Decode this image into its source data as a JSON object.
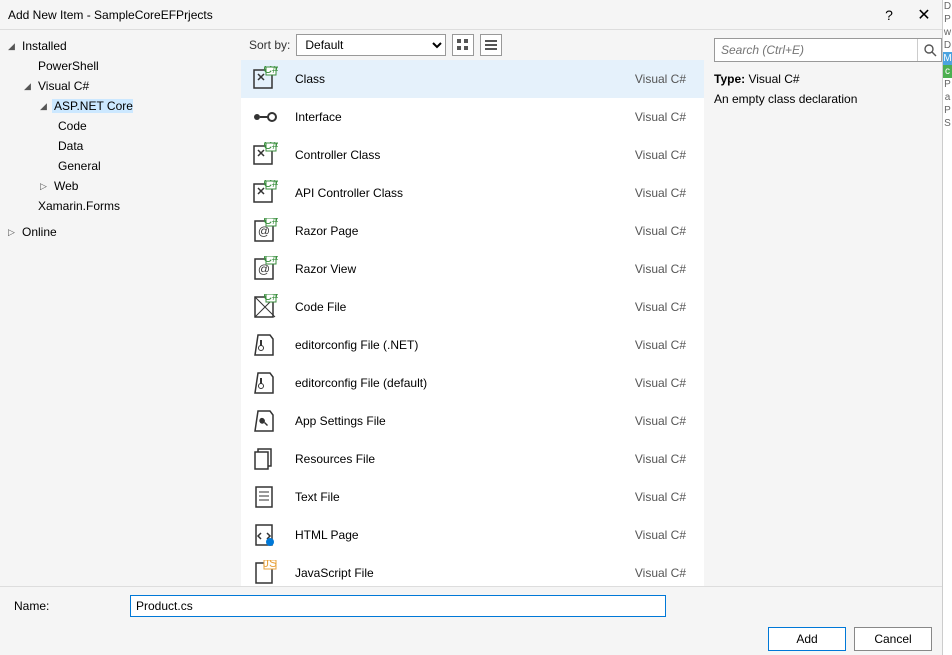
{
  "window": {
    "title": "Add New Item - SampleCoreEFPrjects",
    "help": "?",
    "close": "✕"
  },
  "sidebar": {
    "installed": "Installed",
    "powershell": "PowerShell",
    "visualcs": "Visual C#",
    "aspnetcore": "ASP.NET Core",
    "code": "Code",
    "data": "Data",
    "general": "General",
    "web": "Web",
    "xamarin": "Xamarin.Forms",
    "online": "Online"
  },
  "toolbar": {
    "sortby": "Sort by:",
    "sortvalue": "Default"
  },
  "templates": [
    {
      "name": "Class",
      "lang": "Visual C#",
      "selected": true,
      "icon": "class"
    },
    {
      "name": "Interface",
      "lang": "Visual C#",
      "icon": "interface"
    },
    {
      "name": "Controller Class",
      "lang": "Visual C#",
      "icon": "class"
    },
    {
      "name": "API Controller Class",
      "lang": "Visual C#",
      "icon": "class"
    },
    {
      "name": "Razor Page",
      "lang": "Visual C#",
      "icon": "razor"
    },
    {
      "name": "Razor View",
      "lang": "Visual C#",
      "icon": "razor"
    },
    {
      "name": "Code File",
      "lang": "Visual C#",
      "icon": "codefile"
    },
    {
      "name": "editorconfig File (.NET)",
      "lang": "Visual C#",
      "icon": "config"
    },
    {
      "name": "editorconfig File (default)",
      "lang": "Visual C#",
      "icon": "config"
    },
    {
      "name": "App Settings File",
      "lang": "Visual C#",
      "icon": "wrench"
    },
    {
      "name": "Resources File",
      "lang": "Visual C#",
      "icon": "files"
    },
    {
      "name": "Text File",
      "lang": "Visual C#",
      "icon": "text"
    },
    {
      "name": "HTML Page",
      "lang": "Visual C#",
      "icon": "html"
    },
    {
      "name": "JavaScript File",
      "lang": "Visual C#",
      "icon": "js"
    }
  ],
  "search": {
    "placeholder": "Search (Ctrl+E)"
  },
  "description": {
    "type_label": "Type:",
    "type_value": "Visual C#",
    "text": "An empty class declaration"
  },
  "footer": {
    "name_label": "Name:",
    "name_value": "Product.cs",
    "add": "Add",
    "cancel": "Cancel"
  },
  "rside": [
    "D",
    "P",
    "w",
    "D",
    "M",
    "c",
    "P",
    "a",
    "P",
    "S"
  ]
}
